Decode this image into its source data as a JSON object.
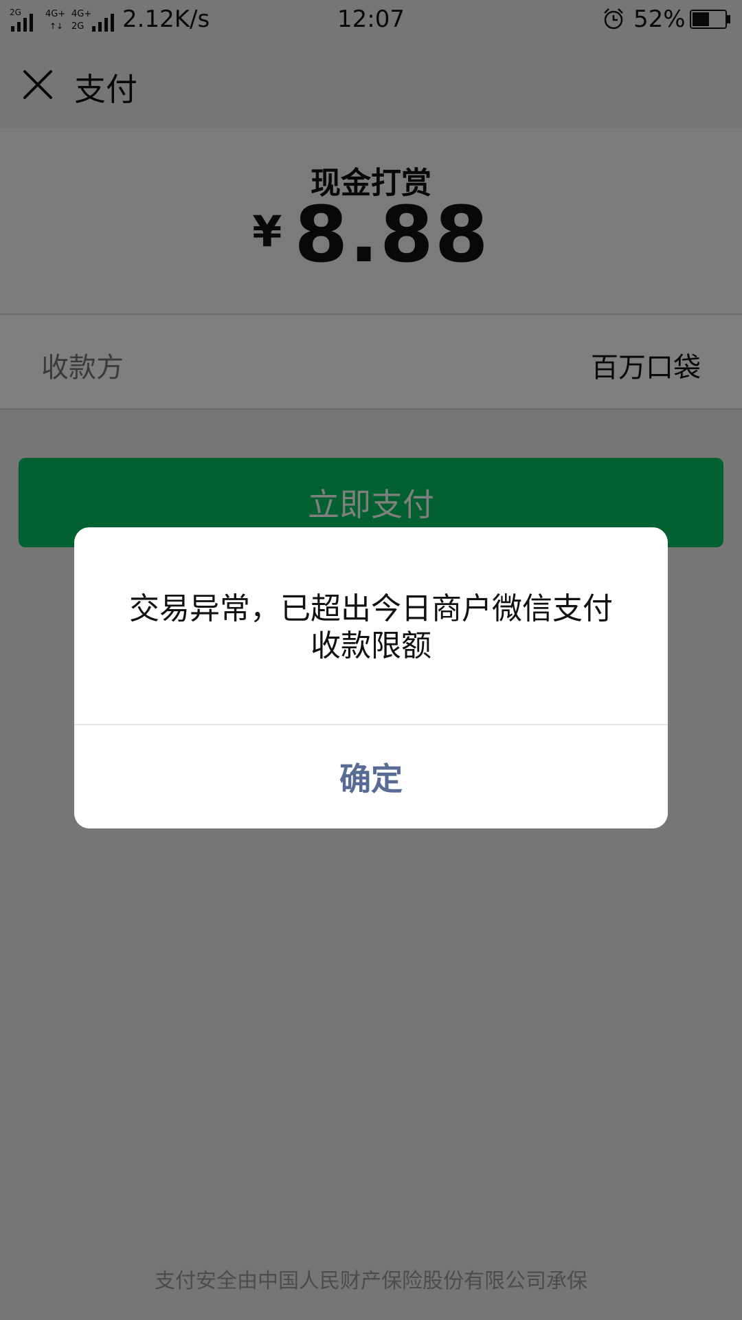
{
  "status_bar": {
    "signal_1": "2G",
    "signal_2": "4G+",
    "signal_3": "4G+ 2G",
    "speed": "2.12K/s",
    "time": "12:07",
    "alarm_icon": "alarm-clock-icon",
    "battery_percent": "52%",
    "battery_level": 0.52
  },
  "nav": {
    "close_icon": "close-icon",
    "title": "支付"
  },
  "payment": {
    "label": "现金打赏",
    "currency": "¥",
    "amount": "8.88",
    "payee_label": "收款方",
    "payee_value": "百万口袋",
    "pay_button_label": "立即支付",
    "footer_note": "支付安全由中国人民财产保险股份有限公司承保"
  },
  "dialog": {
    "message": "交易异常，已超出今日商户微信支付收款限额",
    "confirm_label": "确定"
  },
  "colors": {
    "primary_green": "#07c160",
    "link_blue": "#576b95",
    "background": "#ededed"
  }
}
